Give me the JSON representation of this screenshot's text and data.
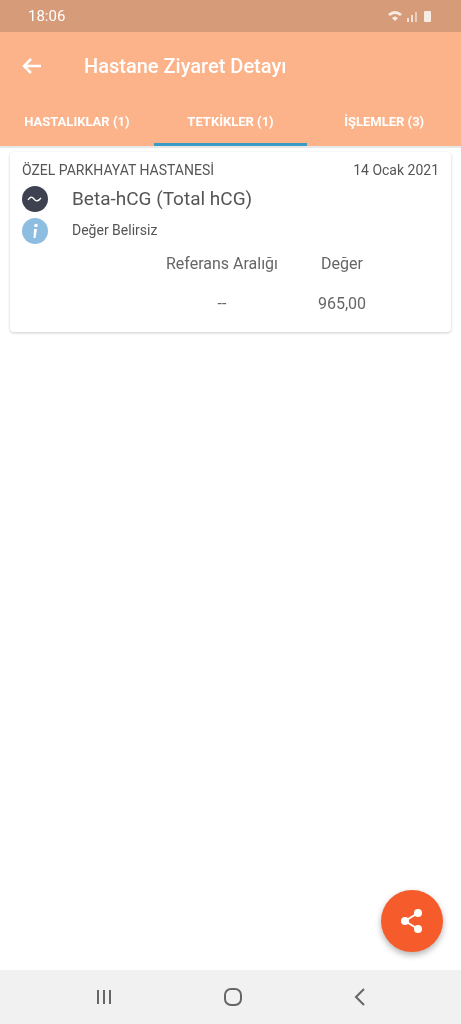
{
  "status_bar": {
    "time": "18:06"
  },
  "app_bar": {
    "title": "Hastane Ziyaret Detayı"
  },
  "tabs": [
    {
      "label": "HASTALIKLAR (1)",
      "selected": false
    },
    {
      "label": "TETKİKLER (1)",
      "selected": true
    },
    {
      "label": "İŞLEMLER (3)",
      "selected": false
    }
  ],
  "results": [
    {
      "hospital": "ÖZEL PARKHAYAT HASTANESİ",
      "date": "14 Ocak 2021",
      "test": "Beta-hCG (Total hCG)",
      "status": "Değer Belirsiz",
      "reference_header": "Referans Aralığı",
      "value_header": "Değer",
      "reference": "--",
      "value": "965,00"
    }
  ]
}
